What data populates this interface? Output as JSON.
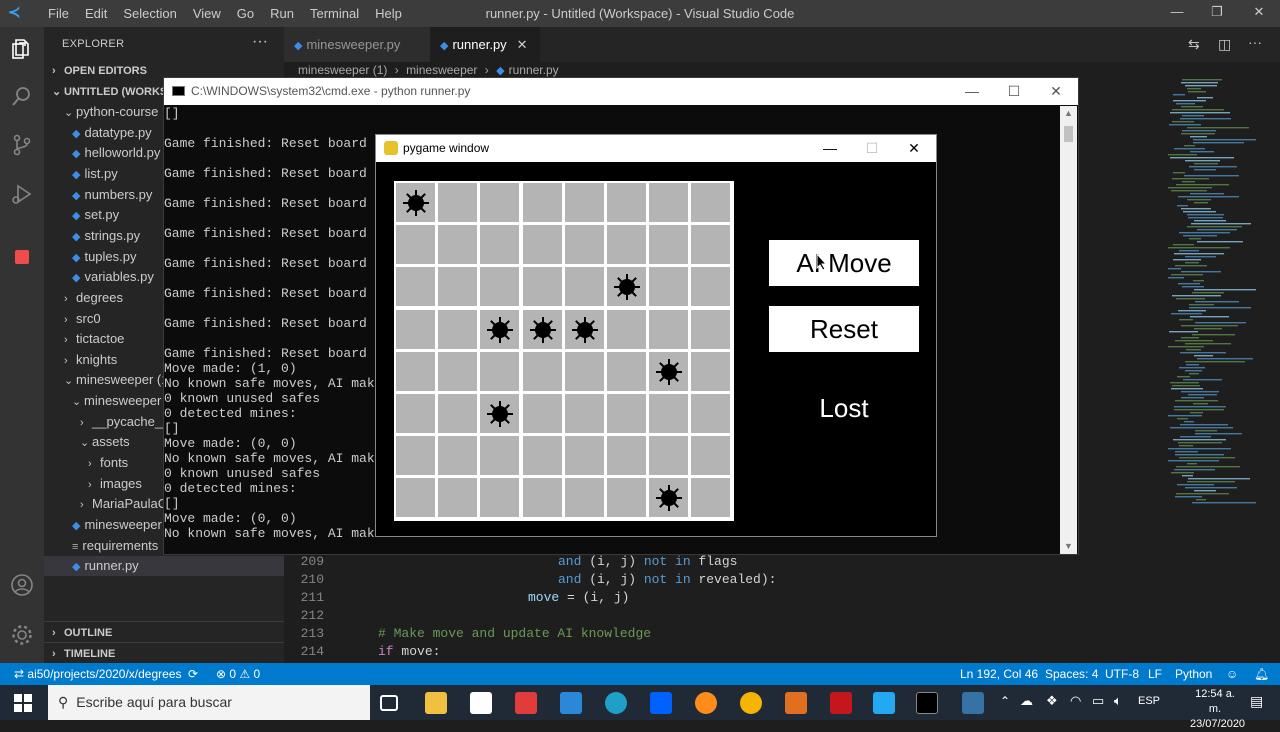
{
  "titlebar": {
    "menu": [
      "File",
      "Edit",
      "Selection",
      "View",
      "Go",
      "Run",
      "Terminal",
      "Help"
    ],
    "window_title": "runner.py - Untitled (Workspace) - Visual Studio Code"
  },
  "sidebar": {
    "header": "EXPLORER",
    "open_editors": "OPEN EDITORS",
    "workspace": "UNTITLED (WORKSPA",
    "items": [
      {
        "label": "python-course",
        "type": "folder-open"
      },
      {
        "label": "datatype.py",
        "type": "py"
      },
      {
        "label": "helloworld.py",
        "type": "py"
      },
      {
        "label": "list.py",
        "type": "py"
      },
      {
        "label": "numbers.py",
        "type": "py"
      },
      {
        "label": "set.py",
        "type": "py"
      },
      {
        "label": "strings.py",
        "type": "py"
      },
      {
        "label": "tuples.py",
        "type": "py"
      },
      {
        "label": "variables.py",
        "type": "py"
      },
      {
        "label": "degrees",
        "type": "folder"
      },
      {
        "label": "src0",
        "type": "folder"
      },
      {
        "label": "tictactoe",
        "type": "folder"
      },
      {
        "label": "knights",
        "type": "folder"
      },
      {
        "label": "minesweeper (1",
        "type": "folder-open"
      },
      {
        "label": "minesweeper",
        "type": "folder-open"
      },
      {
        "label": "__pycache__",
        "type": "folder"
      },
      {
        "label": "assets",
        "type": "folder-open"
      },
      {
        "label": "fonts",
        "type": "folder"
      },
      {
        "label": "images",
        "type": "folder"
      },
      {
        "label": "MariaPaulaCa",
        "type": "folder"
      },
      {
        "label": "minesweeper",
        "type": "py"
      },
      {
        "label": "requirements",
        "type": "txt"
      },
      {
        "label": "runner.py",
        "type": "py"
      }
    ],
    "outline": "OUTLINE",
    "timeline": "TIMELINE"
  },
  "tabs": [
    {
      "label": "minesweeper.py"
    },
    {
      "label": "runner.py"
    }
  ],
  "breadcrumb": [
    "minesweeper (1)",
    "minesweeper",
    "runner.py"
  ],
  "code": [
    {
      "num": "209",
      "text": ""
    },
    {
      "num": "210",
      "text": ""
    },
    {
      "num": "211",
      "text": ""
    },
    {
      "num": "212",
      "text": ""
    },
    {
      "num": "213",
      "text": "# Make move and update AI knowledge"
    },
    {
      "num": "214",
      "text": ""
    }
  ],
  "code_parts": {
    "l209": [
      "and",
      " (i, j) ",
      "not in",
      " flags"
    ],
    "l210": [
      "and",
      " (i, j) ",
      "not in",
      " revealed):"
    ],
    "l211": [
      "move",
      " = (i, j)"
    ],
    "l214": [
      "if",
      " move:"
    ]
  },
  "cmd": {
    "title": "C:\\WINDOWS\\system32\\cmd.exe - python  runner.py",
    "text": "[]\n\nGame finished: Reset board t\n\nGame finished: Reset board t\n\nGame finished: Reset board t\n\nGame finished: Reset board t\n\nGame finished: Reset board t\n\nGame finished: Reset board t\n\nGame finished: Reset board t\n\nGame finished: Reset board t\nMove made: (1, 0)\nNo known safe moves, AI makin\n0 known unused safes\n0 detected mines:\n[]\nMove made: (0, 0)\nNo known safe moves, AI makin\n0 known unused safes\n0 detected mines:\n[]\nMove made: (0, 0)\nNo known safe moves, AI makin"
  },
  "pygame": {
    "title": "pygame window",
    "buttons": {
      "ai_move": "AI Move",
      "reset": "Reset"
    },
    "status": "Lost",
    "rows": 8,
    "cols": 8,
    "mines": [
      [
        0,
        0
      ],
      [
        2,
        5
      ],
      [
        3,
        2
      ],
      [
        3,
        3
      ],
      [
        3,
        4
      ],
      [
        4,
        6
      ],
      [
        5,
        2
      ],
      [
        7,
        6
      ]
    ]
  },
  "statusbar": {
    "path": "ai50/projects/2020/x/degrees",
    "problems": "⊗ 0 ⚠ 0",
    "position": "Ln 192, Col 46",
    "spaces": "Spaces: 4",
    "encoding": "UTF-8",
    "eol": "LF",
    "language": "Python"
  },
  "taskbar": {
    "search_placeholder": "Escribe aquí para buscar",
    "lang": "ESP",
    "time": "12:54 a. m.",
    "date": "23/07/2020"
  },
  "colors": {
    "vscode_blue": "#007acc",
    "cell_gray": "#b4b4b4"
  }
}
